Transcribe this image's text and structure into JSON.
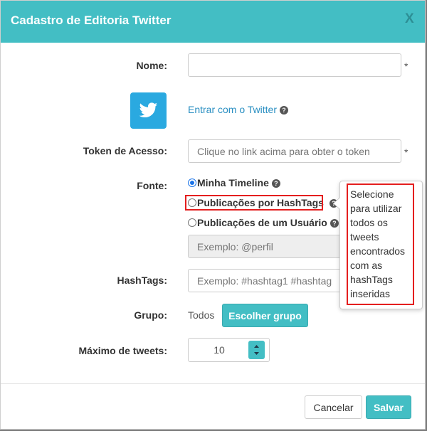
{
  "modal": {
    "title": "Cadastro de Editoria Twitter",
    "close_label": "X"
  },
  "form": {
    "nome": {
      "label": "Nome:",
      "value": "",
      "required": "*"
    },
    "twitter": {
      "link_label": "Entrar com o Twitter"
    },
    "token": {
      "label": "Token de Acesso:",
      "placeholder": "Clique no link acima para obter o token",
      "required": "*"
    },
    "fonte": {
      "label": "Fonte:",
      "options": [
        {
          "label": "Minha Timeline",
          "checked": true
        },
        {
          "label": "Publicações por HashTags",
          "checked": false
        },
        {
          "label": "Publicações de um Usuário",
          "checked": false
        }
      ],
      "perfil_placeholder": "Exemplo: @perfil"
    },
    "hashtags": {
      "label": "HashTags:",
      "placeholder": "Exemplo: #hashtag1 #hashtag2"
    },
    "grupo": {
      "label": "Grupo:",
      "value": "Todos",
      "button": "Escolher grupo"
    },
    "max_tweets": {
      "label": "Máximo de tweets:",
      "value": "10"
    }
  },
  "tooltip": {
    "lines": [
      "Selecione",
      "para utilizar",
      "todos os",
      "tweets",
      "encontrados",
      "com as",
      "hashTags",
      "inseridas"
    ]
  },
  "footer": {
    "cancel": "Cancelar",
    "save": "Salvar"
  },
  "colors": {
    "header": "#43bec4",
    "primary": "#43bec4",
    "highlight": "#e41e1e",
    "twitter": "#2aa9e0",
    "link": "#2a8fc2"
  },
  "icons": [
    "twitter-bird-icon",
    "question-circle-icon",
    "spinner-arrows-icon"
  ]
}
